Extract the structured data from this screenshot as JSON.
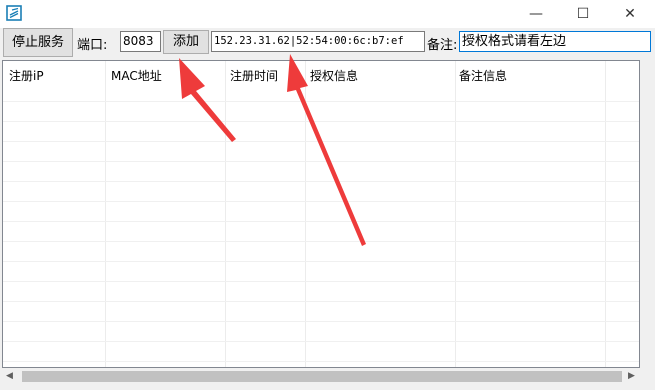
{
  "window": {
    "minimize": "—",
    "maximize": "☐",
    "close": "✕"
  },
  "toolbar": {
    "stop_label": "停止服务",
    "port_label": "端口:",
    "port_value": "8083",
    "add_label": "添加",
    "auth_value": "152.23.31.62|52:54:00:6c:b7:ef",
    "note_label": "备注:",
    "note_value": "授权格式请看左边"
  },
  "table": {
    "columns": [
      "注册iP",
      "MAC地址",
      "注册时间",
      "授权信息",
      "备注信息"
    ]
  },
  "scrollbar": {
    "left_arrow": "◀",
    "right_arrow": "▶"
  },
  "colors": {
    "annotation_arrow": "#ee3b3b",
    "accent": "#0078d7"
  }
}
